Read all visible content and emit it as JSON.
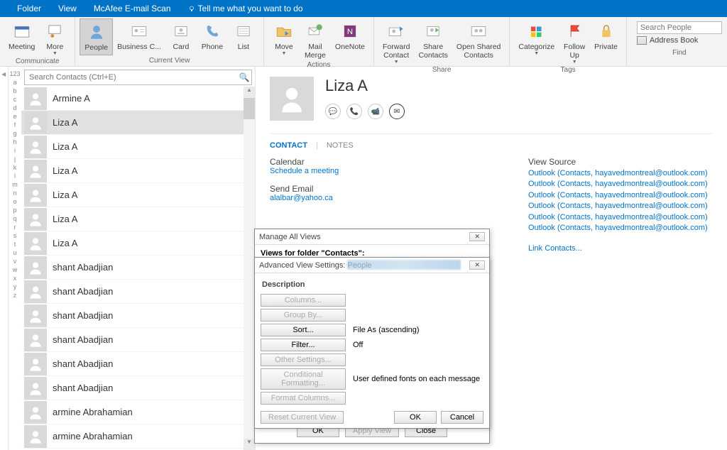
{
  "menubar": {
    "items": [
      "Folder",
      "View",
      "McAfee E-mail Scan"
    ],
    "tell": "Tell me what you want to do"
  },
  "ribbon": {
    "communicate": {
      "label": "Communicate",
      "meeting": "Meeting",
      "more": "More"
    },
    "currentview": {
      "label": "Current View",
      "people": "People",
      "business": "Business C...",
      "card": "Card",
      "phone": "Phone",
      "list": "List"
    },
    "actions": {
      "label": "Actions",
      "move": "Move",
      "mailmerge": "Mail\nMerge",
      "onenote": "OneNote"
    },
    "share": {
      "label": "Share",
      "forward": "Forward\nContact",
      "sharec": "Share\nContacts",
      "openshared": "Open Shared\nContacts"
    },
    "tags": {
      "label": "Tags",
      "categorize": "Categorize",
      "followup": "Follow\nUp",
      "private": "Private"
    },
    "find": {
      "label": "Find",
      "search_placeholder": "Search People",
      "addressbook": "Address Book"
    }
  },
  "search": {
    "placeholder": "Search Contacts (Ctrl+E)"
  },
  "alpha": [
    "123",
    "a",
    "b",
    "c",
    "d",
    "e",
    "f",
    "g",
    "h",
    "i",
    "j",
    "k",
    "l",
    "m",
    "n",
    "o",
    "p",
    "q",
    "r",
    "s",
    "t",
    "u",
    "v",
    "w",
    "x",
    "y",
    "z"
  ],
  "contacts": [
    {
      "name": "Armine A",
      "selected": false
    },
    {
      "name": "Liza A",
      "selected": true
    },
    {
      "name": "Liza A",
      "selected": false
    },
    {
      "name": "Liza A",
      "selected": false
    },
    {
      "name": "Liza A",
      "selected": false
    },
    {
      "name": "Liza A",
      "selected": false
    },
    {
      "name": "Liza A",
      "selected": false
    },
    {
      "name": "shant Abadjian",
      "selected": false
    },
    {
      "name": "shant Abadjian",
      "selected": false
    },
    {
      "name": "shant Abadjian",
      "selected": false
    },
    {
      "name": "shant Abadjian",
      "selected": false
    },
    {
      "name": "shant Abadjian",
      "selected": false
    },
    {
      "name": "shant Abadjian",
      "selected": false
    },
    {
      "name": "armine Abrahamian",
      "selected": false
    },
    {
      "name": "armine Abrahamian",
      "selected": false
    }
  ],
  "detail": {
    "name": "Liza A",
    "tab_contact": "CONTACT",
    "tab_notes": "NOTES",
    "calendar": "Calendar",
    "schedule": "Schedule a meeting",
    "sendemail": "Send Email",
    "email": "alalbar@yahoo.ca",
    "viewsource": "View Source",
    "sources": [
      "Outlook (Contacts, hayavedmontreal@outlook.com)",
      "Outlook (Contacts, hayavedmontreal@outlook.com)",
      "Outlook (Contacts, hayavedmontreal@outlook.com)",
      "Outlook (Contacts, hayavedmontreal@outlook.com)",
      "Outlook (Contacts, hayavedmontreal@outlook.com)",
      "Outlook (Contacts, hayavedmontreal@outlook.com)"
    ],
    "linkcontacts": "Link Contacts..."
  },
  "dlg_manage": {
    "title": "Manage All Views",
    "subtitle": "Views for folder \"Contacts\":",
    "ok": "OK",
    "apply": "Apply View",
    "close": "Close"
  },
  "dlg_adv": {
    "title": "Advanced View Settings: People",
    "desc": "Description",
    "columns": "Columns...",
    "groupby": "Group By...",
    "sort": "Sort...",
    "sort_val": "File As (ascending)",
    "filter": "Filter...",
    "filter_val": "Off",
    "other": "Other Settings...",
    "cond": "Conditional Formatting...",
    "cond_val": "User defined fonts on each message",
    "format": "Format Columns...",
    "reset": "Reset Current View",
    "ok": "OK",
    "cancel": "Cancel"
  }
}
